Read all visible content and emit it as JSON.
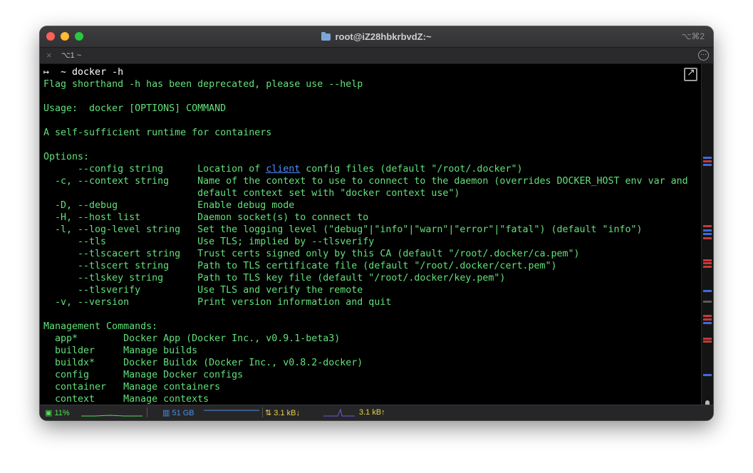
{
  "window": {
    "title": "root@iZ28hbkrbvdZ:~",
    "shortcut": "⌥⌘2"
  },
  "tab": {
    "close_glyph": "×",
    "label": "⌥1  ~",
    "menu_glyph": "···"
  },
  "terminal": {
    "prompt_symbol": "↦  ~",
    "command": " docker -h",
    "lines": [
      "Flag shorthand -h has been deprecated, please use --help",
      "",
      "Usage:  docker [OPTIONS] COMMAND",
      "",
      "A self-sufficient runtime for containers",
      "",
      "Options:"
    ],
    "config_prefix": "      --config string      Location of ",
    "config_link": "client",
    "config_suffix": " config files (default \"/root/.docker\")",
    "options_lines": [
      "  -c, --context string     Name of the context to use to connect to the daemon (overrides DOCKER_HOST env var and",
      "                           default context set with \"docker context use\")",
      "  -D, --debug              Enable debug mode",
      "  -H, --host list          Daemon socket(s) to connect to",
      "  -l, --log-level string   Set the logging level (\"debug\"|\"info\"|\"warn\"|\"error\"|\"fatal\") (default \"info\")",
      "      --tls                Use TLS; implied by --tlsverify",
      "      --tlscacert string   Trust certs signed only by this CA (default \"/root/.docker/ca.pem\")",
      "      --tlscert string     Path to TLS certificate file (default \"/root/.docker/cert.pem\")",
      "      --tlskey string      Path to TLS key file (default \"/root/.docker/key.pem\")",
      "      --tlsverify          Use TLS and verify the remote",
      "  -v, --version            Print version information and quit",
      "",
      "Management Commands:",
      "  app*        Docker App (Docker Inc., v0.9.1-beta3)",
      "  builder     Manage builds",
      "  buildx*     Docker Buildx (Docker Inc., v0.8.2-docker)",
      "  config      Manage Docker configs",
      "  container   Manage containers",
      "  context     Manage contexts"
    ]
  },
  "status": {
    "cpu": "11%",
    "memory": "51 GB",
    "net_down": "3.1 kB↓",
    "net_up": "3.1 kB↑",
    "colors": {
      "cpu": "#4ee04e",
      "memory": "#4f8fe8",
      "network": "#e8d24a"
    }
  }
}
